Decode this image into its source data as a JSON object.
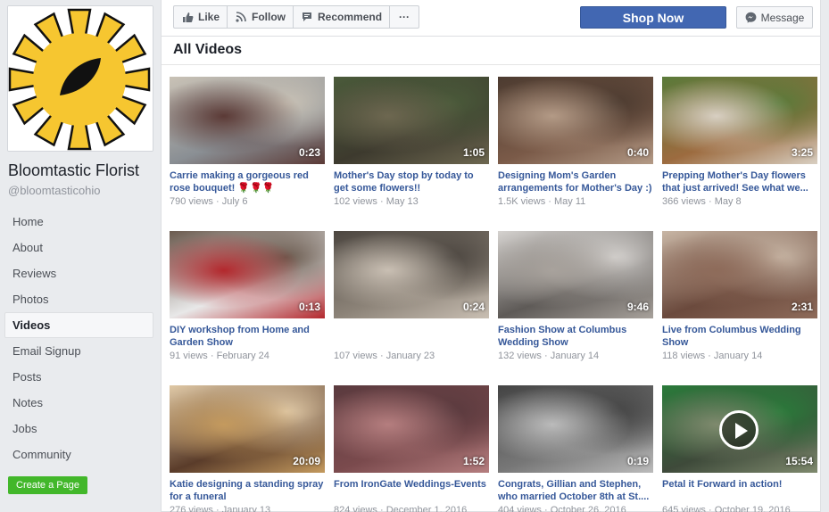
{
  "page": {
    "name": "Bloomtastic Florist",
    "handle": "@bloomtasticohio"
  },
  "nav": {
    "items": [
      {
        "label": "Home",
        "active": false
      },
      {
        "label": "About",
        "active": false
      },
      {
        "label": "Reviews",
        "active": false
      },
      {
        "label": "Photos",
        "active": false
      },
      {
        "label": "Videos",
        "active": true
      },
      {
        "label": "Email Signup",
        "active": false
      },
      {
        "label": "Posts",
        "active": false
      },
      {
        "label": "Notes",
        "active": false
      },
      {
        "label": "Jobs",
        "active": false
      },
      {
        "label": "Community",
        "active": false
      }
    ],
    "create_page_label": "Create a Page"
  },
  "toolbar": {
    "like_label": "Like",
    "follow_label": "Follow",
    "recommend_label": "Recommend",
    "more_label": "···",
    "shop_now_label": "Shop Now",
    "message_label": "Message"
  },
  "videos": {
    "header": "All Videos",
    "items": [
      {
        "title": "Carrie making a gorgeous red rose bouquet! 🌹🌹🌹",
        "views": "790 views",
        "date": "July 6",
        "duration": "0:23",
        "thumb": [
          "#8a8f94",
          "#5b3a36",
          "#c9c2b6"
        ],
        "playing": false
      },
      {
        "title": "Mother's Day stop by today to get some flowers!!",
        "views": "102 views",
        "date": "May 13",
        "duration": "1:05",
        "thumb": [
          "#3d3a2e",
          "#6d6750",
          "#4a5a3a"
        ],
        "playing": false
      },
      {
        "title": "Designing Mom's Garden arrangements for Mother's Day :)",
        "views": "1.5K views",
        "date": "May 11",
        "duration": "0:40",
        "thumb": [
          "#7a5a48",
          "#b39a86",
          "#4c3b30"
        ],
        "playing": false
      },
      {
        "title": "Prepping Mother's Day flowers that just arrived! See what we...",
        "views": "366 views",
        "date": "May 8",
        "duration": "3:25",
        "thumb": [
          "#9c6b3f",
          "#d8cfc2",
          "#5a7a3a"
        ],
        "playing": false
      },
      {
        "title": "DIY workshop from Home and Garden Show",
        "views": "91 views",
        "date": "February 24",
        "duration": "0:13",
        "thumb": [
          "#e8e8e8",
          "#b3282d",
          "#6b5b4f"
        ],
        "playing": false
      },
      {
        "title": "",
        "views": "107 views",
        "date": "January 23",
        "duration": "0:24",
        "thumb": [
          "#8c8378",
          "#c9bfb3",
          "#4c4640"
        ],
        "playing": false
      },
      {
        "title": "Fashion Show at Columbus Wedding Show",
        "views": "132 views",
        "date": "January 14",
        "duration": "9:46",
        "thumb": [
          "#5e5a57",
          "#a8a29c",
          "#d5d2cf"
        ],
        "playing": false
      },
      {
        "title": "Live from Columbus Wedding Show",
        "views": "118 views",
        "date": "January 14",
        "duration": "2:31",
        "thumb": [
          "#6b4a3d",
          "#8e6b5a",
          "#c8b6a5"
        ],
        "playing": false
      },
      {
        "title": "Katie designing a standing spray for a funeral",
        "views": "276 views",
        "date": "January 13",
        "duration": "20:09",
        "thumb": [
          "#5a3c2a",
          "#c49a5e",
          "#e0c9a6"
        ],
        "playing": false
      },
      {
        "title": "From IronGate Weddings-Events",
        "views": "824 views",
        "date": "December 1, 2016",
        "duration": "1:52",
        "thumb": [
          "#7a4a4d",
          "#b57e7f",
          "#5a3a3e"
        ],
        "playing": false
      },
      {
        "title": "Congrats, Gillian and Stephen, who married October 8th at St....",
        "views": "404 views",
        "date": "October 26, 2016",
        "duration": "0:19",
        "thumb": [
          "#777",
          "#bbb",
          "#444"
        ],
        "playing": false
      },
      {
        "title": "Petal it Forward in action!",
        "views": "645 views",
        "date": "October 19, 2016",
        "duration": "15:54",
        "thumb": [
          "#3e4a3a",
          "#7f8a6e",
          "#2a7a3a"
        ],
        "playing": true
      }
    ]
  }
}
